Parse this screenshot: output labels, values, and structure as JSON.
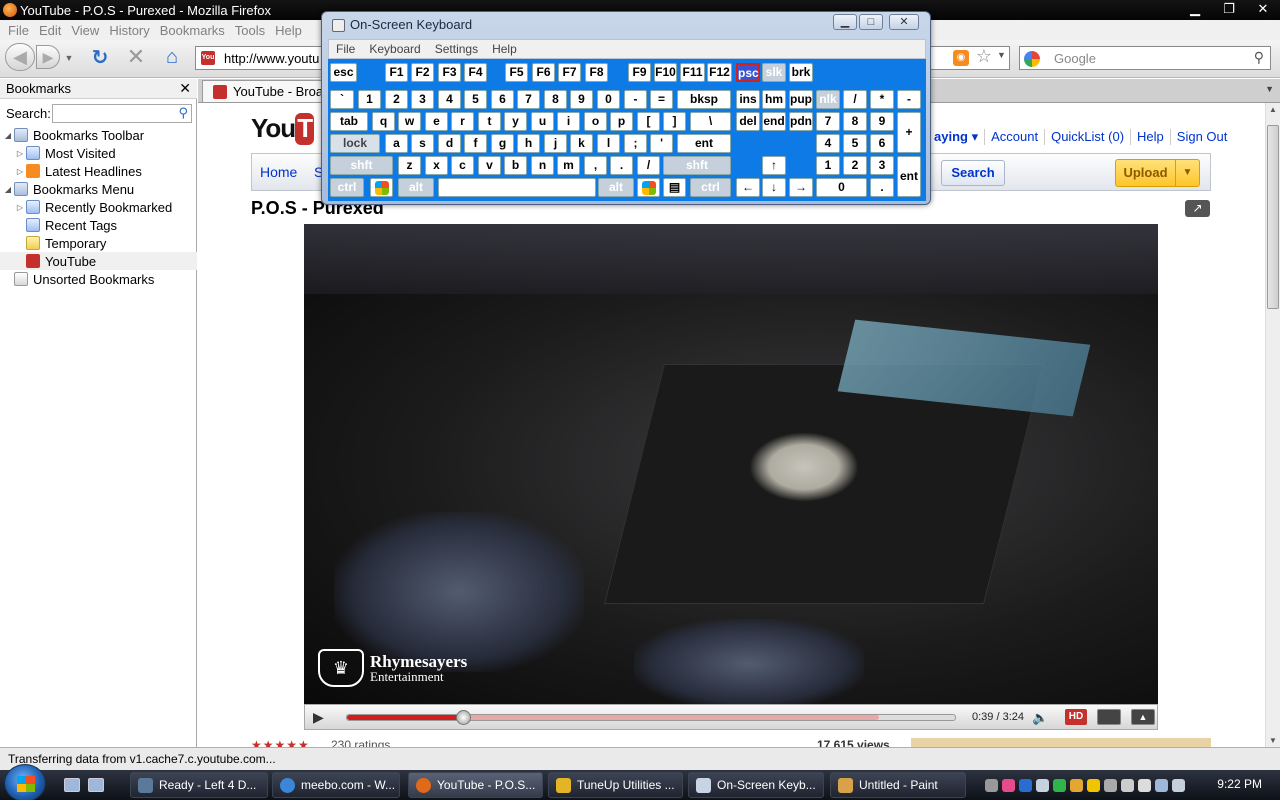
{
  "firefox": {
    "title": "YouTube - P.O.S - Purexed - Mozilla Firefox",
    "menu": [
      "File",
      "Edit",
      "View",
      "History",
      "Bookmarks",
      "Tools",
      "Help"
    ],
    "url": "http://www.youtu",
    "search_placeholder": "Google",
    "status": "Transferring data from v1.cache7.c.youtube.com..."
  },
  "sidebar": {
    "header": "Bookmarks",
    "search_label": "Search:",
    "items": [
      {
        "label": "Bookmarks Toolbar",
        "icon": "bookmarks-toolbar-icon"
      },
      {
        "label": "Most Visited",
        "icon": "smart-folder-icon"
      },
      {
        "label": "Latest Headlines",
        "icon": "rss-icon"
      },
      {
        "label": "Bookmarks Menu",
        "icon": "bookmarks-menu-icon"
      },
      {
        "label": "Recently Bookmarked",
        "icon": "smart-folder-icon"
      },
      {
        "label": "Recent Tags",
        "icon": "smart-folder-icon"
      },
      {
        "label": "Temporary",
        "icon": "folder-icon"
      },
      {
        "label": "YouTube",
        "icon": "youtube-icon"
      },
      {
        "label": "Unsorted Bookmarks",
        "icon": "unsorted-bookmarks-icon"
      }
    ]
  },
  "tab": {
    "label": "YouTube - Broad"
  },
  "youtube": {
    "logo": "You",
    "links": [
      "aying ▾",
      "Account",
      "QuickList (0)",
      "Help",
      "Sign Out"
    ],
    "nav_home": "Home",
    "nav_s": "S",
    "search_button": "Search",
    "upload_button": "Upload",
    "video_title": "P.O.S - Purexed",
    "watermark_line1": "Rhymesayers",
    "watermark_line2": "Entertainment",
    "time": "0:39 / 3:24",
    "hd": "HD",
    "ratings": "230 ratings",
    "views": "17,615 views",
    "progress_played": 0.191,
    "progress_loaded": 0.875
  },
  "osk": {
    "title": "On-Screen Keyboard",
    "menu": [
      "File",
      "Keyboard",
      "Settings",
      "Help"
    ],
    "rows": {
      "row0": [
        "esc",
        "F1",
        "F2",
        "F3",
        "F4",
        "F5",
        "F6",
        "F7",
        "F8",
        "F9",
        "F10",
        "F11",
        "F12",
        "psc",
        "slk",
        "brk"
      ],
      "row1": [
        "`",
        "1",
        "2",
        "3",
        "4",
        "5",
        "6",
        "7",
        "8",
        "9",
        "0",
        "-",
        "=",
        "bksp",
        "ins",
        "hm",
        "pup",
        "nlk",
        "/",
        "*",
        "-"
      ],
      "row2": [
        "tab",
        "q",
        "w",
        "e",
        "r",
        "t",
        "y",
        "u",
        "i",
        "o",
        "p",
        "[",
        "]",
        "\\",
        "del",
        "end",
        "pdn",
        "7",
        "8",
        "9",
        "+"
      ],
      "row3": [
        "lock",
        "a",
        "s",
        "d",
        "f",
        "g",
        "h",
        "j",
        "k",
        "l",
        ";",
        "'",
        "ent",
        "4",
        "5",
        "6"
      ],
      "row4": [
        "shft",
        "z",
        "x",
        "c",
        "v",
        "b",
        "n",
        "m",
        ",",
        ".",
        "/",
        "shft",
        "↑",
        "1",
        "2",
        "3",
        "ent"
      ],
      "row5": [
        "ctrl",
        "alt",
        "alt",
        "ctrl",
        "←",
        "↓",
        "→",
        "0",
        "."
      ]
    }
  },
  "taskbar": {
    "tasks": [
      "Ready - Left 4 D...",
      "meebo.com - W...",
      "YouTube - P.O.S...",
      "TuneUp Utilities ...",
      "On-Screen Keyb...",
      "Untitled - Paint"
    ],
    "clock": "9:22 PM"
  }
}
